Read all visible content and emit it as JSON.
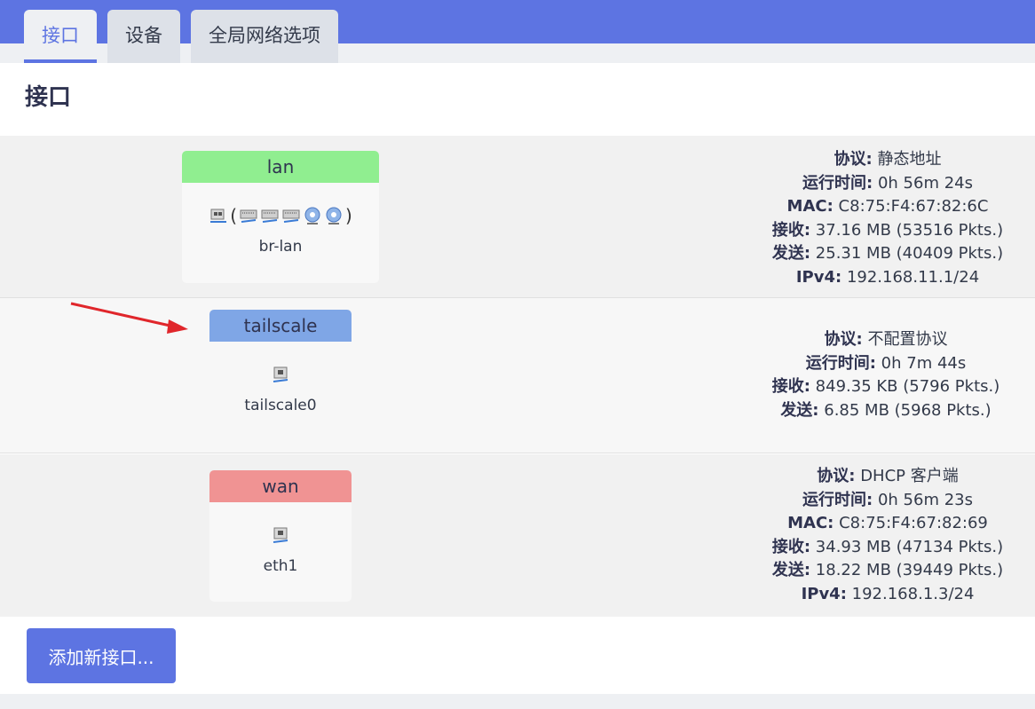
{
  "tabs": [
    {
      "label": "接口",
      "active": true
    },
    {
      "label": "设备",
      "active": false
    },
    {
      "label": "全局网络选项",
      "active": false
    }
  ],
  "page_title": "接口",
  "interfaces": [
    {
      "name": "lan",
      "header_color": "#90ee90",
      "device": "br-lan",
      "icons": [
        "bridge-icon",
        "ethernet-port-icon",
        "ethernet-port-icon",
        "ethernet-port-icon",
        "wireless-icon",
        "wireless-icon"
      ],
      "info": [
        {
          "label": "协议:",
          "value": "静态地址"
        },
        {
          "label": "运行时间:",
          "value": "0h 56m 24s"
        },
        {
          "label": "MAC:",
          "value": "C8:75:F4:67:82:6C"
        },
        {
          "label": "接收:",
          "value": "37.16 MB (53516 Pkts.)"
        },
        {
          "label": "发送:",
          "value": "25.31 MB (40409 Pkts.)"
        },
        {
          "label": "IPv4:",
          "value": "192.168.11.1/24"
        }
      ]
    },
    {
      "name": "tailscale",
      "header_color": "#7fa6e6",
      "device": "tailscale0",
      "icons": [
        "ethernet-icon"
      ],
      "info": [
        {
          "label": "协议:",
          "value": "不配置协议"
        },
        {
          "label": "运行时间:",
          "value": "0h 7m 44s"
        },
        {
          "label": "接收:",
          "value": "849.35 KB (5796 Pkts.)"
        },
        {
          "label": "发送:",
          "value": "6.85 MB (5968 Pkts.)"
        }
      ]
    },
    {
      "name": "wan",
      "header_color": "#f09393",
      "device": "eth1",
      "icons": [
        "ethernet-icon"
      ],
      "info": [
        {
          "label": "协议:",
          "value": "DHCP 客户端"
        },
        {
          "label": "运行时间:",
          "value": "0h 56m 23s"
        },
        {
          "label": "MAC:",
          "value": "C8:75:F4:67:82:69"
        },
        {
          "label": "接收:",
          "value": "34.93 MB (47134 Pkts.)"
        },
        {
          "label": "发送:",
          "value": "18.22 MB (39449 Pkts.)"
        },
        {
          "label": "IPv4:",
          "value": "192.168.1.3/24"
        }
      ]
    }
  ],
  "add_button_label": "添加新接口...",
  "colors": {
    "accent": "#5d74e2",
    "annotation_arrow": "#e0262b"
  }
}
